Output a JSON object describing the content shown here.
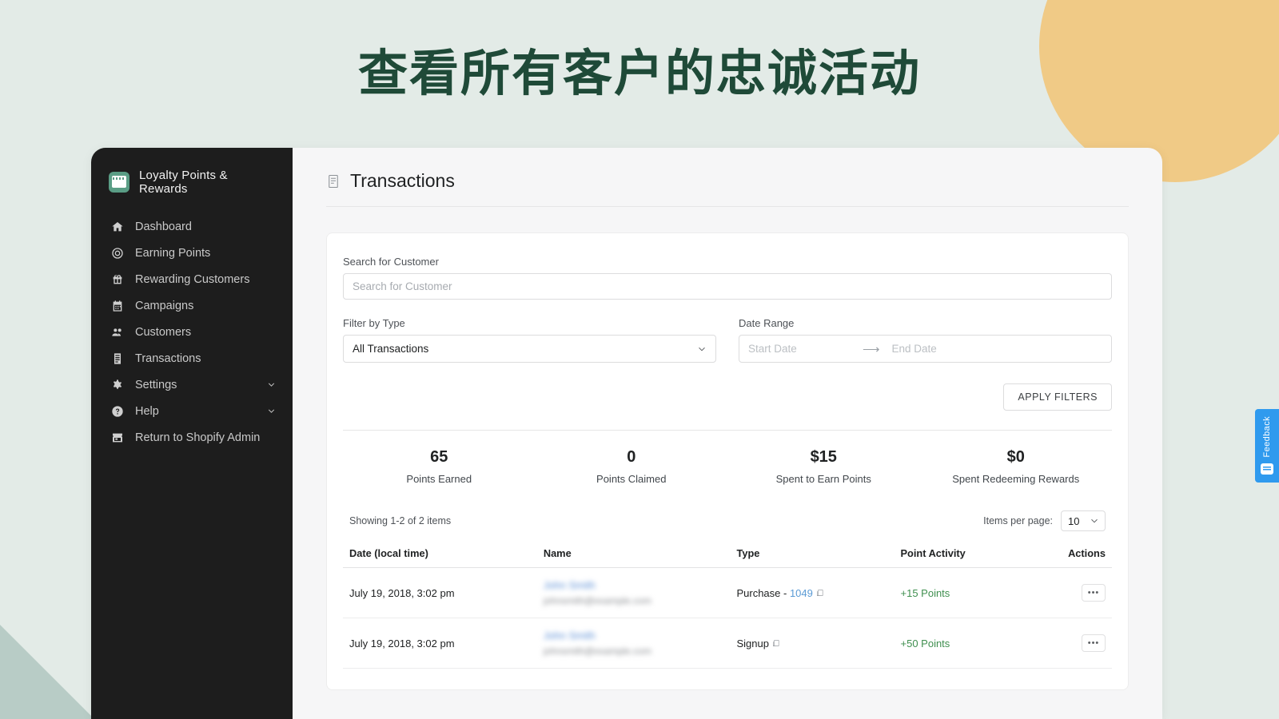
{
  "hero": {
    "title": "查看所有客户的忠诚活动"
  },
  "colors": {
    "page_bg": "#e3ebe7",
    "title_green": "#1f4a38",
    "circle_yellow": "#f0ca86",
    "triangle_sage": "#b8ccc6",
    "sidebar_dark": "#1d1d1d",
    "accent_blue": "#2f9aee",
    "points_green": "#3f8f4f",
    "link_blue": "#5b9bd5"
  },
  "sidebar": {
    "brand": {
      "name": "Loyalty Points & Rewards",
      "icon": "app-logo-icon"
    },
    "items": [
      {
        "label": "Dashboard",
        "icon": "home-icon",
        "chevron": false
      },
      {
        "label": "Earning Points",
        "icon": "target-icon",
        "chevron": false
      },
      {
        "label": "Rewarding Customers",
        "icon": "gift-icon",
        "chevron": false
      },
      {
        "label": "Campaigns",
        "icon": "calendar-icon",
        "chevron": false
      },
      {
        "label": "Customers",
        "icon": "people-icon",
        "chevron": false
      },
      {
        "label": "Transactions",
        "icon": "list-icon",
        "chevron": false
      },
      {
        "label": "Settings",
        "icon": "gear-icon",
        "chevron": true
      },
      {
        "label": "Help",
        "icon": "help-icon",
        "chevron": true
      },
      {
        "label": "Return to Shopify Admin",
        "icon": "store-icon",
        "chevron": false
      }
    ]
  },
  "page": {
    "title": "Transactions",
    "title_icon": "transactions-icon"
  },
  "filters": {
    "search_label": "Search for Customer",
    "search_value": "",
    "search_placeholder": "Search for Customer",
    "type_label": "Filter by Type",
    "type_value": "All Transactions",
    "date_label": "Date Range",
    "start_placeholder": "Start Date",
    "start_value": "",
    "end_placeholder": "End Date",
    "end_value": "",
    "apply_label": "APPLY FILTERS"
  },
  "stats": [
    {
      "value": "65",
      "label": "Points Earned"
    },
    {
      "value": "0",
      "label": "Points Claimed"
    },
    {
      "value": "$15",
      "label": "Spent to Earn Points"
    },
    {
      "value": "$0",
      "label": "Spent Redeeming Rewards"
    }
  ],
  "table": {
    "showing": "Showing 1-2 of 2 items",
    "items_per_page_label": "Items per page:",
    "items_per_page_value": "10",
    "headers": {
      "date": "Date (local time)",
      "name": "Name",
      "type": "Type",
      "points": "Point Activity",
      "actions": "Actions"
    },
    "rows": [
      {
        "date": "July 19, 2018, 3:02 pm",
        "name": "John Smith",
        "email": "johnsmith@example.com",
        "type_prefix": "Purchase - ",
        "type_order": "1049",
        "points": "+15 Points",
        "action_label": "•••"
      },
      {
        "date": "July 19, 2018, 3:02 pm",
        "name": "John Smith",
        "email": "johnsmith@example.com",
        "type_prefix": "Signup",
        "type_order": "",
        "points": "+50 Points",
        "action_label": "•••"
      }
    ]
  },
  "feedback": {
    "label": "Feedback",
    "icon": "feedback-icon"
  }
}
